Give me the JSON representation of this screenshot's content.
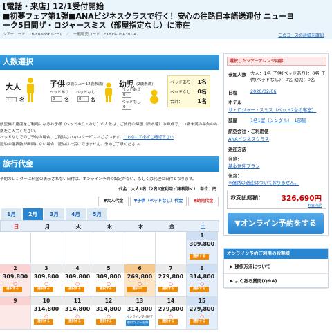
{
  "header": {
    "line1": "[電話・来店] 12/1受付開始",
    "line2": "■初夢フェア第1弾■ANAビジネスクラスで行く！安心の往路日本語送迎付 ニューヨーク5日間ザ・ロジャースミス（部屋指定なし）に滞在",
    "codes": "ツアーコード：TB-FNN8561-FH1　／　一般販売コード：EX819-USA301-A",
    "detail_link": "このコースの詳細を確認"
  },
  "people": {
    "title": "人数選択",
    "adult": "大人",
    "child": "子供",
    "child_note": "(2歳以上〜12歳未満)",
    "infant": "幼児",
    "infant_note": "(2歳未満)",
    "bed_yes": "ベッドあり",
    "bed_no": "ベッドなし",
    "unit": "名",
    "adult_count": "1",
    "child_bed": "0",
    "child_nobed": "0",
    "infant_bed": "0",
    "infant_nobed": "0",
    "summary": {
      "r1": "ベッドあり：",
      "v1": "1名",
      "r2": "ベッドなし：",
      "v2": "0名",
      "r3": "合計：",
      "v3": "1名"
    }
  },
  "notes": {
    "n1": "航空機の座席をご利用になるお子様（ベッドあり・なし）の人数は、ご旅行の帰国（日本着）の時点で、12歳未満の場合のお数をご入力ください。",
    "n2": "ベッドなしでのご予約の場合、ご提供されないサービスがございます。",
    "n2_link": "こちらにて必ずご確認下さい",
    "n3": "延泊の選択肢が画面にない場合、延泊はお受けできません。予めご了承ください。"
  },
  "price": {
    "title": "旅行代金",
    "note": "予約カレンダーに料金の表示されない日付は、オンライン予約の設定がない、もしくは代理の日付となります。",
    "legend": "代金：大人1名（2名1室利用／諸税除く）　単位：円",
    "tabs": [
      "▼大人代金",
      "▼子供（ベッドなし）代金",
      "▼幼児代金"
    ],
    "months": [
      "1月",
      "2月",
      "3月",
      "4月",
      "5月"
    ],
    "dow": [
      "日",
      "月",
      "火",
      "水",
      "木",
      "金",
      "土"
    ]
  },
  "calendar": {
    "btn": "選択する",
    "online_btn": "他のツアーを探す",
    "online_cap": "オンライン受付終了",
    "weeks": [
      [
        {
          "d": "",
          "p": ""
        },
        {
          "d": "",
          "p": ""
        },
        {
          "d": "",
          "p": ""
        },
        {
          "d": "",
          "p": ""
        },
        {
          "d": "",
          "p": ""
        },
        {
          "d": "",
          "p": ""
        },
        {
          "d": "1",
          "p": "309,800",
          "c": "",
          "b": "選択する"
        }
      ],
      [
        {
          "d": "2",
          "p": "309,800",
          "c": "○",
          "b": "選択する"
        },
        {
          "d": "3",
          "p": "309,800",
          "c": "○",
          "b": "選択する"
        },
        {
          "d": "4",
          "p": "309,800",
          "c": "○",
          "b": "選択する"
        },
        {
          "d": "5",
          "p": "309,800",
          "c": "○",
          "b": "選択する"
        },
        {
          "d": "6",
          "p": "269,800",
          "c": "○",
          "b": "選択中",
          "hl": true
        },
        {
          "d": "7",
          "p": "279,800",
          "c": "○",
          "b": "選択する"
        },
        {
          "d": "8",
          "p": "314,800",
          "c": "○",
          "b": "選択する"
        }
      ],
      [
        {
          "d": "9",
          "p": "",
          "c": "",
          "b": ""
        },
        {
          "d": "10",
          "p": "314,800",
          "c": "○",
          "b": "選択する"
        },
        {
          "d": "11",
          "p": "314,800",
          "c": "○",
          "b": "選択する"
        },
        {
          "d": "12",
          "p": "314,800",
          "c": "○",
          "b": "選択する"
        },
        {
          "d": "13",
          "p": "314,800",
          "c": "",
          "b": "",
          "online": true
        },
        {
          "d": "14",
          "p": "279,800",
          "c": "○",
          "b": "選択する"
        },
        {
          "d": "15",
          "p": "279,800",
          "c": "○",
          "b": "選択する"
        }
      ]
    ]
  },
  "sidebar": {
    "head": "選択したツアーアレンジ内容",
    "pax_label": "参加人数",
    "pax_value_pre": "大人：1名 子供(ベッドあり)：0名 子供(ベッドなし)：0名 幼児：0名",
    "date_label": "日程",
    "date_value": "2020/02/06",
    "hotel_label": "ホテル",
    "hotel_value": "ザ・ロジャー・スミス（ベッド2台の客室）",
    "room_label": "部屋",
    "room_value": "1名1室（シングル）　1部屋",
    "airline_label": "航空会社・ご利用便",
    "airline_value": "ANAビジネスクラス",
    "transfer_label": "送迎方法",
    "outbound": "往路：",
    "outbound_value": "基本送迎プラン",
    "inbound": "復路：",
    "inbound_value": "※復路の送迎はついておりません。",
    "total_label": "お支払総額：",
    "total_value": "326,690円",
    "total_sub": "料金内訳",
    "book_button": "▼オンライン予約をする"
  },
  "help": {
    "title": "オンライン予約ご利用のお客様",
    "item1": "▶ 操作方法について",
    "item2": "▶ よくある質問(Q&A)"
  }
}
